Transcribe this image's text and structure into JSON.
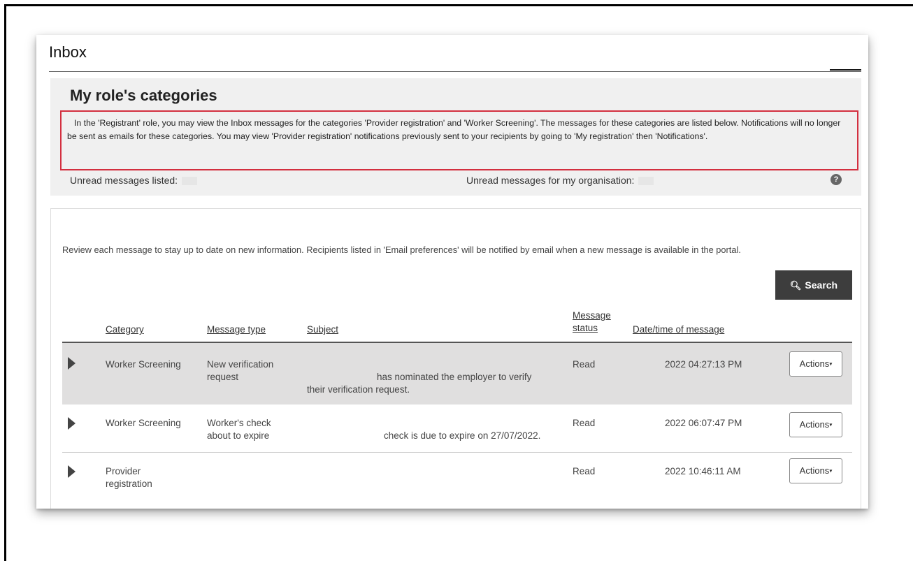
{
  "page": {
    "title": "Inbox"
  },
  "roles": {
    "heading": "My role's categories",
    "notice": "In the 'Registrant' role, you may view the Inbox messages for the categories 'Provider registration' and 'Worker Screening'. The messages for these categories are listed below. Notifications will no longer be sent as emails for these categories. You may view 'Provider registration' notifications previously sent to your recipients by going to 'My registration' then 'Notifications'.",
    "unread_listed_label": "Unread messages listed:",
    "unread_org_label": "Unread messages for my organisation:",
    "help_icon": "question-circle-icon"
  },
  "content": {
    "review_text": "Review each message to stay up to date on new information. Recipients listed in 'Email preferences' will be notified by email when a new message is available in the portal.",
    "search_label": "Search",
    "search_icon": "magnifier-icon"
  },
  "table": {
    "headers": {
      "category": "Category",
      "message_type": "Message type",
      "subject": "Subject",
      "message_status_1": "Message",
      "message_status_2": "status",
      "datetime": "Date/time of message"
    },
    "rows": [
      {
        "category": "Worker Screening",
        "message_type_1": "New verification",
        "message_type_2": "request",
        "subject_1": "has nominated the employer to verify",
        "subject_2": "their verification request.",
        "status": "Read",
        "datetime": "2022 04:27:13 PM",
        "action": "Actions"
      },
      {
        "category": "Worker Screening",
        "message_type_1": "Worker's check",
        "message_type_2": "about to expire",
        "subject_1": "check is due to expire on 27/07/2022.",
        "subject_2": "",
        "status": "Read",
        "datetime": "2022 06:07:47 PM",
        "action": "Actions"
      },
      {
        "category_1": "Provider",
        "category_2": "registration",
        "message_type_1": "",
        "message_type_2": "",
        "subject_1": "",
        "subject_2": "",
        "status": "Read",
        "datetime": "2022 10:46:11 AM",
        "action": "Actions"
      }
    ]
  }
}
